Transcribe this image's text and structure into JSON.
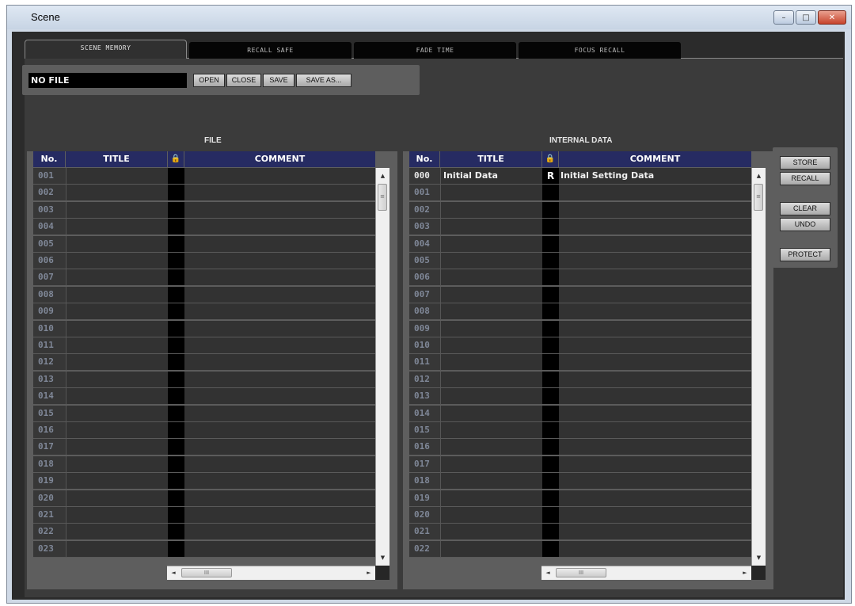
{
  "window": {
    "title": "Scene",
    "minimize": "–",
    "maximize": "□",
    "close": "✕"
  },
  "tabs": [
    {
      "label": "SCENE MEMORY"
    },
    {
      "label": "RECALL SAFE"
    },
    {
      "label": "FADE TIME"
    },
    {
      "label": "FOCUS RECALL"
    }
  ],
  "file_bar": {
    "filename": "NO FILE",
    "open_label": "OPEN",
    "close_label": "CLOSE",
    "save_label": "SAVE",
    "save_as_label": "SAVE AS..."
  },
  "file_panel": {
    "heading": "FILE",
    "columns": {
      "no": "No.",
      "title": "TITLE",
      "lock": "🔒",
      "comment": "COMMENT"
    },
    "rows": [
      {
        "no": "001",
        "title": "",
        "lock": "",
        "comment": ""
      },
      {
        "no": "002",
        "title": "",
        "lock": "",
        "comment": ""
      },
      {
        "no": "003",
        "title": "",
        "lock": "",
        "comment": ""
      },
      {
        "no": "004",
        "title": "",
        "lock": "",
        "comment": ""
      },
      {
        "no": "005",
        "title": "",
        "lock": "",
        "comment": ""
      },
      {
        "no": "006",
        "title": "",
        "lock": "",
        "comment": ""
      },
      {
        "no": "007",
        "title": "",
        "lock": "",
        "comment": ""
      },
      {
        "no": "008",
        "title": "",
        "lock": "",
        "comment": ""
      },
      {
        "no": "009",
        "title": "",
        "lock": "",
        "comment": ""
      },
      {
        "no": "010",
        "title": "",
        "lock": "",
        "comment": ""
      },
      {
        "no": "011",
        "title": "",
        "lock": "",
        "comment": ""
      },
      {
        "no": "012",
        "title": "",
        "lock": "",
        "comment": ""
      },
      {
        "no": "013",
        "title": "",
        "lock": "",
        "comment": ""
      },
      {
        "no": "014",
        "title": "",
        "lock": "",
        "comment": ""
      },
      {
        "no": "015",
        "title": "",
        "lock": "",
        "comment": ""
      },
      {
        "no": "016",
        "title": "",
        "lock": "",
        "comment": ""
      },
      {
        "no": "017",
        "title": "",
        "lock": "",
        "comment": ""
      },
      {
        "no": "018",
        "title": "",
        "lock": "",
        "comment": ""
      },
      {
        "no": "019",
        "title": "",
        "lock": "",
        "comment": ""
      },
      {
        "no": "020",
        "title": "",
        "lock": "",
        "comment": ""
      },
      {
        "no": "021",
        "title": "",
        "lock": "",
        "comment": ""
      },
      {
        "no": "022",
        "title": "",
        "lock": "",
        "comment": ""
      },
      {
        "no": "023",
        "title": "",
        "lock": "",
        "comment": ""
      }
    ]
  },
  "internal_panel": {
    "heading": "INTERNAL DATA",
    "columns": {
      "no": "No.",
      "title": "TITLE",
      "lock": "🔒",
      "comment": "COMMENT"
    },
    "rows": [
      {
        "no": "000",
        "title": "Initial Data",
        "lock": "R",
        "comment": "Initial Setting Data"
      },
      {
        "no": "001",
        "title": "",
        "lock": "",
        "comment": ""
      },
      {
        "no": "002",
        "title": "",
        "lock": "",
        "comment": ""
      },
      {
        "no": "003",
        "title": "",
        "lock": "",
        "comment": ""
      },
      {
        "no": "004",
        "title": "",
        "lock": "",
        "comment": ""
      },
      {
        "no": "005",
        "title": "",
        "lock": "",
        "comment": ""
      },
      {
        "no": "006",
        "title": "",
        "lock": "",
        "comment": ""
      },
      {
        "no": "007",
        "title": "",
        "lock": "",
        "comment": ""
      },
      {
        "no": "008",
        "title": "",
        "lock": "",
        "comment": ""
      },
      {
        "no": "009",
        "title": "",
        "lock": "",
        "comment": ""
      },
      {
        "no": "010",
        "title": "",
        "lock": "",
        "comment": ""
      },
      {
        "no": "011",
        "title": "",
        "lock": "",
        "comment": ""
      },
      {
        "no": "012",
        "title": "",
        "lock": "",
        "comment": ""
      },
      {
        "no": "013",
        "title": "",
        "lock": "",
        "comment": ""
      },
      {
        "no": "014",
        "title": "",
        "lock": "",
        "comment": ""
      },
      {
        "no": "015",
        "title": "",
        "lock": "",
        "comment": ""
      },
      {
        "no": "016",
        "title": "",
        "lock": "",
        "comment": ""
      },
      {
        "no": "017",
        "title": "",
        "lock": "",
        "comment": ""
      },
      {
        "no": "018",
        "title": "",
        "lock": "",
        "comment": ""
      },
      {
        "no": "019",
        "title": "",
        "lock": "",
        "comment": ""
      },
      {
        "no": "020",
        "title": "",
        "lock": "",
        "comment": ""
      },
      {
        "no": "021",
        "title": "",
        "lock": "",
        "comment": ""
      },
      {
        "no": "022",
        "title": "",
        "lock": "",
        "comment": ""
      }
    ]
  },
  "side_buttons": {
    "store": "STORE",
    "recall": "RECALL",
    "clear": "CLEAR",
    "undo": "UNDO",
    "protect": "PROTECT"
  },
  "scroll": {
    "up": "▲",
    "down": "▼",
    "left": "◄",
    "right": "►",
    "grip_v": "≡",
    "grip_h": "III"
  }
}
